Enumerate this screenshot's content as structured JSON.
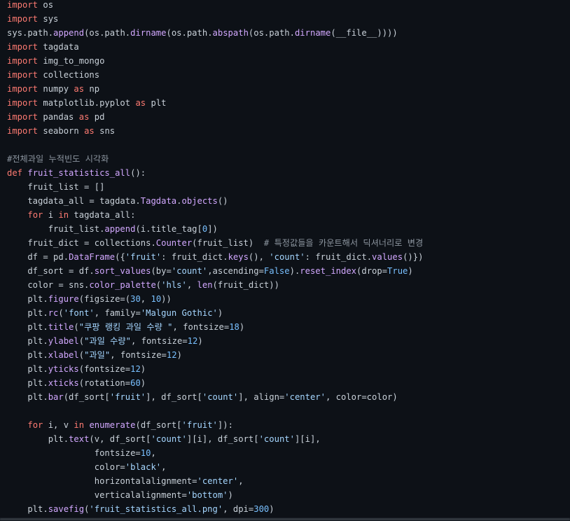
{
  "code_lines": [
    [
      {
        "t": "kw",
        "v": "import"
      },
      {
        "t": "pl",
        "v": " os"
      }
    ],
    [
      {
        "t": "kw",
        "v": "import"
      },
      {
        "t": "pl",
        "v": " sys"
      }
    ],
    [
      {
        "t": "pl",
        "v": "sys.path."
      },
      {
        "t": "fn",
        "v": "append"
      },
      {
        "t": "pl",
        "v": "(os.path."
      },
      {
        "t": "fn",
        "v": "dirname"
      },
      {
        "t": "pl",
        "v": "(os.path."
      },
      {
        "t": "fn",
        "v": "abspath"
      },
      {
        "t": "pl",
        "v": "(os.path."
      },
      {
        "t": "fn",
        "v": "dirname"
      },
      {
        "t": "pl",
        "v": "(__file__))))"
      }
    ],
    [
      {
        "t": "kw",
        "v": "import"
      },
      {
        "t": "pl",
        "v": " tagdata"
      }
    ],
    [
      {
        "t": "kw",
        "v": "import"
      },
      {
        "t": "pl",
        "v": " img_to_mongo"
      }
    ],
    [
      {
        "t": "kw",
        "v": "import"
      },
      {
        "t": "pl",
        "v": " collections"
      }
    ],
    [
      {
        "t": "kw",
        "v": "import"
      },
      {
        "t": "pl",
        "v": " numpy "
      },
      {
        "t": "kw",
        "v": "as"
      },
      {
        "t": "pl",
        "v": " np"
      }
    ],
    [
      {
        "t": "kw",
        "v": "import"
      },
      {
        "t": "pl",
        "v": " matplotlib.pyplot "
      },
      {
        "t": "kw",
        "v": "as"
      },
      {
        "t": "pl",
        "v": " plt"
      }
    ],
    [
      {
        "t": "kw",
        "v": "import"
      },
      {
        "t": "pl",
        "v": " pandas "
      },
      {
        "t": "kw",
        "v": "as"
      },
      {
        "t": "pl",
        "v": " pd"
      }
    ],
    [
      {
        "t": "kw",
        "v": "import"
      },
      {
        "t": "pl",
        "v": " seaborn "
      },
      {
        "t": "kw",
        "v": "as"
      },
      {
        "t": "pl",
        "v": " sns"
      }
    ],
    [],
    [
      {
        "t": "cm",
        "v": "#전체과일 누적빈도 시각화"
      }
    ],
    [
      {
        "t": "kw",
        "v": "def"
      },
      {
        "t": "pl",
        "v": " "
      },
      {
        "t": "fn",
        "v": "fruit_statistics_all"
      },
      {
        "t": "pl",
        "v": "():"
      }
    ],
    [
      {
        "t": "pl",
        "v": "    fruit_list = []"
      }
    ],
    [
      {
        "t": "pl",
        "v": "    tagdata_all = tagdata."
      },
      {
        "t": "fn",
        "v": "Tagdata"
      },
      {
        "t": "pl",
        "v": "."
      },
      {
        "t": "fn",
        "v": "objects"
      },
      {
        "t": "pl",
        "v": "()"
      }
    ],
    [
      {
        "t": "pl",
        "v": "    "
      },
      {
        "t": "kw",
        "v": "for"
      },
      {
        "t": "pl",
        "v": " i "
      },
      {
        "t": "kw",
        "v": "in"
      },
      {
        "t": "pl",
        "v": " tagdata_all:"
      }
    ],
    [
      {
        "t": "pl",
        "v": "        fruit_list."
      },
      {
        "t": "fn",
        "v": "append"
      },
      {
        "t": "pl",
        "v": "(i.title_tag["
      },
      {
        "t": "num",
        "v": "0"
      },
      {
        "t": "pl",
        "v": "])"
      }
    ],
    [
      {
        "t": "pl",
        "v": "    fruit_dict = collections."
      },
      {
        "t": "fn",
        "v": "Counter"
      },
      {
        "t": "pl",
        "v": "(fruit_list)  "
      },
      {
        "t": "cm",
        "v": "# 특정값들을 카운트해서 딕셔너리로 변경"
      }
    ],
    [
      {
        "t": "pl",
        "v": "    df = pd."
      },
      {
        "t": "fn",
        "v": "DataFrame"
      },
      {
        "t": "pl",
        "v": "({"
      },
      {
        "t": "str",
        "v": "'fruit'"
      },
      {
        "t": "pl",
        "v": ": fruit_dict."
      },
      {
        "t": "fn",
        "v": "keys"
      },
      {
        "t": "pl",
        "v": "(), "
      },
      {
        "t": "str",
        "v": "'count'"
      },
      {
        "t": "pl",
        "v": ": fruit_dict."
      },
      {
        "t": "fn",
        "v": "values"
      },
      {
        "t": "pl",
        "v": "()})"
      }
    ],
    [
      {
        "t": "pl",
        "v": "    df_sort = df."
      },
      {
        "t": "fn",
        "v": "sort_values"
      },
      {
        "t": "pl",
        "v": "(by="
      },
      {
        "t": "str",
        "v": "'count'"
      },
      {
        "t": "pl",
        "v": ",ascending="
      },
      {
        "t": "num",
        "v": "False"
      },
      {
        "t": "pl",
        "v": ")."
      },
      {
        "t": "fn",
        "v": "reset_index"
      },
      {
        "t": "pl",
        "v": "(drop="
      },
      {
        "t": "num",
        "v": "True"
      },
      {
        "t": "pl",
        "v": ")"
      }
    ],
    [
      {
        "t": "pl",
        "v": "    color = sns."
      },
      {
        "t": "fn",
        "v": "color_palette"
      },
      {
        "t": "pl",
        "v": "("
      },
      {
        "t": "str",
        "v": "'hls'"
      },
      {
        "t": "pl",
        "v": ", "
      },
      {
        "t": "fn",
        "v": "len"
      },
      {
        "t": "pl",
        "v": "(fruit_dict))"
      }
    ],
    [
      {
        "t": "pl",
        "v": "    plt."
      },
      {
        "t": "fn",
        "v": "figure"
      },
      {
        "t": "pl",
        "v": "(figsize=("
      },
      {
        "t": "num",
        "v": "30"
      },
      {
        "t": "pl",
        "v": ", "
      },
      {
        "t": "num",
        "v": "10"
      },
      {
        "t": "pl",
        "v": "))"
      }
    ],
    [
      {
        "t": "pl",
        "v": "    plt."
      },
      {
        "t": "fn",
        "v": "rc"
      },
      {
        "t": "pl",
        "v": "("
      },
      {
        "t": "str",
        "v": "'font'"
      },
      {
        "t": "pl",
        "v": ", family="
      },
      {
        "t": "str",
        "v": "'Malgun Gothic'"
      },
      {
        "t": "pl",
        "v": ")"
      }
    ],
    [
      {
        "t": "pl",
        "v": "    plt."
      },
      {
        "t": "fn",
        "v": "title"
      },
      {
        "t": "pl",
        "v": "("
      },
      {
        "t": "str",
        "v": "\"쿠팡 랭킹 과일 수량 \""
      },
      {
        "t": "pl",
        "v": ", fontsize="
      },
      {
        "t": "num",
        "v": "18"
      },
      {
        "t": "pl",
        "v": ")"
      }
    ],
    [
      {
        "t": "pl",
        "v": "    plt."
      },
      {
        "t": "fn",
        "v": "ylabel"
      },
      {
        "t": "pl",
        "v": "("
      },
      {
        "t": "str",
        "v": "\"과일 수량\""
      },
      {
        "t": "pl",
        "v": ", fontsize="
      },
      {
        "t": "num",
        "v": "12"
      },
      {
        "t": "pl",
        "v": ")"
      }
    ],
    [
      {
        "t": "pl",
        "v": "    plt."
      },
      {
        "t": "fn",
        "v": "xlabel"
      },
      {
        "t": "pl",
        "v": "("
      },
      {
        "t": "str",
        "v": "\"과일\""
      },
      {
        "t": "pl",
        "v": ", fontsize="
      },
      {
        "t": "num",
        "v": "12"
      },
      {
        "t": "pl",
        "v": ")"
      }
    ],
    [
      {
        "t": "pl",
        "v": "    plt."
      },
      {
        "t": "fn",
        "v": "yticks"
      },
      {
        "t": "pl",
        "v": "(fontsize="
      },
      {
        "t": "num",
        "v": "12"
      },
      {
        "t": "pl",
        "v": ")"
      }
    ],
    [
      {
        "t": "pl",
        "v": "    plt."
      },
      {
        "t": "fn",
        "v": "xticks"
      },
      {
        "t": "pl",
        "v": "(rotation="
      },
      {
        "t": "num",
        "v": "60"
      },
      {
        "t": "pl",
        "v": ")"
      }
    ],
    [
      {
        "t": "pl",
        "v": "    plt."
      },
      {
        "t": "fn",
        "v": "bar"
      },
      {
        "t": "pl",
        "v": "(df_sort["
      },
      {
        "t": "str",
        "v": "'fruit'"
      },
      {
        "t": "pl",
        "v": "], df_sort["
      },
      {
        "t": "str",
        "v": "'count'"
      },
      {
        "t": "pl",
        "v": "], align="
      },
      {
        "t": "str",
        "v": "'center'"
      },
      {
        "t": "pl",
        "v": ", color=color)"
      }
    ],
    [],
    [
      {
        "t": "pl",
        "v": "    "
      },
      {
        "t": "kw",
        "v": "for"
      },
      {
        "t": "pl",
        "v": " i, v "
      },
      {
        "t": "kw",
        "v": "in"
      },
      {
        "t": "pl",
        "v": " "
      },
      {
        "t": "fn",
        "v": "enumerate"
      },
      {
        "t": "pl",
        "v": "(df_sort["
      },
      {
        "t": "str",
        "v": "'fruit'"
      },
      {
        "t": "pl",
        "v": "]):"
      }
    ],
    [
      {
        "t": "pl",
        "v": "        plt."
      },
      {
        "t": "fn",
        "v": "text"
      },
      {
        "t": "pl",
        "v": "(v, df_sort["
      },
      {
        "t": "str",
        "v": "'count'"
      },
      {
        "t": "pl",
        "v": "][i], df_sort["
      },
      {
        "t": "str",
        "v": "'count'"
      },
      {
        "t": "pl",
        "v": "][i],"
      }
    ],
    [
      {
        "t": "pl",
        "v": "                 fontsize="
      },
      {
        "t": "num",
        "v": "10"
      },
      {
        "t": "pl",
        "v": ","
      }
    ],
    [
      {
        "t": "pl",
        "v": "                 color="
      },
      {
        "t": "str",
        "v": "'black'"
      },
      {
        "t": "pl",
        "v": ","
      }
    ],
    [
      {
        "t": "pl",
        "v": "                 horizontalalignment="
      },
      {
        "t": "str",
        "v": "'center'"
      },
      {
        "t": "pl",
        "v": ","
      }
    ],
    [
      {
        "t": "pl",
        "v": "                 verticalalignment="
      },
      {
        "t": "str",
        "v": "'bottom'"
      },
      {
        "t": "pl",
        "v": ")"
      }
    ],
    [
      {
        "t": "pl",
        "v": "    plt."
      },
      {
        "t": "fn",
        "v": "savefig"
      },
      {
        "t": "pl",
        "v": "("
      },
      {
        "t": "str",
        "v": "'fruit_statistics_all.png'"
      },
      {
        "t": "pl",
        "v": ", dpi="
      },
      {
        "t": "num",
        "v": "300"
      },
      {
        "t": "pl",
        "v": ")"
      }
    ]
  ],
  "colors": {
    "background": "#0d1117",
    "keyword": "#ff7b72",
    "function": "#d2a8ff",
    "string": "#a5d6ff",
    "number": "#79c0ff",
    "comment": "#8b949e",
    "text": "#c9d1d9"
  }
}
